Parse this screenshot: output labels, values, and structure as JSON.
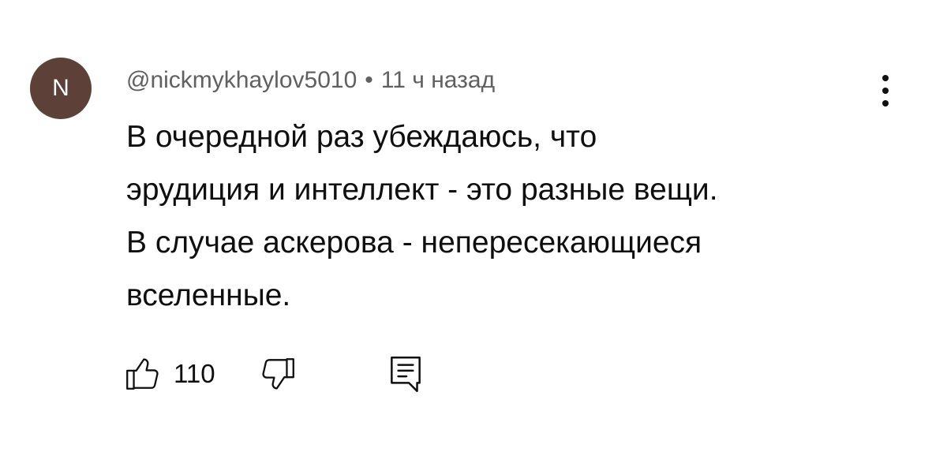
{
  "comment": {
    "avatar_initial": "N",
    "avatar_color": "#5d4037",
    "author": "@nickmykhaylov5010",
    "separator": "•",
    "time": "11 ч назад",
    "text_lines": [
      "В очередной раз убеждаюсь, что",
      "эрудиция и интеллект - это разные вещи.",
      "В случае аскерова - непересекающиеся",
      "вселенные."
    ],
    "like_count": "110"
  },
  "icons": {
    "more": "more-vert-icon",
    "like": "thumb-up-icon",
    "dislike": "thumb-down-icon",
    "reply": "comment-reply-icon"
  }
}
